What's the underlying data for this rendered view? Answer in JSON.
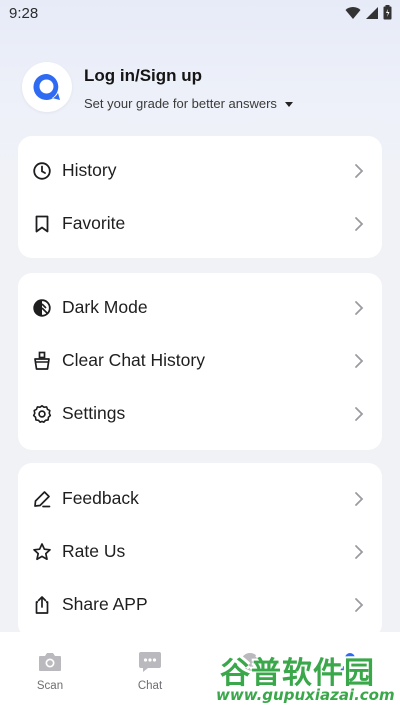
{
  "status_bar": {
    "time": "9:28",
    "icons": [
      "wifi-icon",
      "signal-icon",
      "battery-icon"
    ]
  },
  "profile": {
    "title": "Log in/Sign up",
    "subtitle": "Set your grade for better answers",
    "avatar_icon": "chat-bubble-logo-icon",
    "accent_color": "#2f6bf2"
  },
  "menu": {
    "group1": [
      {
        "label": "History",
        "icon": "clock-icon"
      },
      {
        "label": "Favorite",
        "icon": "bookmark-icon"
      }
    ],
    "group2": [
      {
        "label": "Dark Mode",
        "icon": "dark-mode-icon"
      },
      {
        "label": "Clear Chat History",
        "icon": "broom-icon"
      },
      {
        "label": "Settings",
        "icon": "gear-icon"
      }
    ],
    "group3": [
      {
        "label": "Feedback",
        "icon": "pencil-icon"
      },
      {
        "label": "Rate Us",
        "icon": "star-icon"
      },
      {
        "label": "Share APP",
        "icon": "share-icon"
      }
    ]
  },
  "bottom_nav": [
    {
      "label": "Scan",
      "icon": "camera-icon"
    },
    {
      "label": "Chat",
      "icon": "chat-icon"
    }
  ],
  "watermark": {
    "main": "谷普软件园",
    "url": "www.gupuxiazai.com"
  }
}
